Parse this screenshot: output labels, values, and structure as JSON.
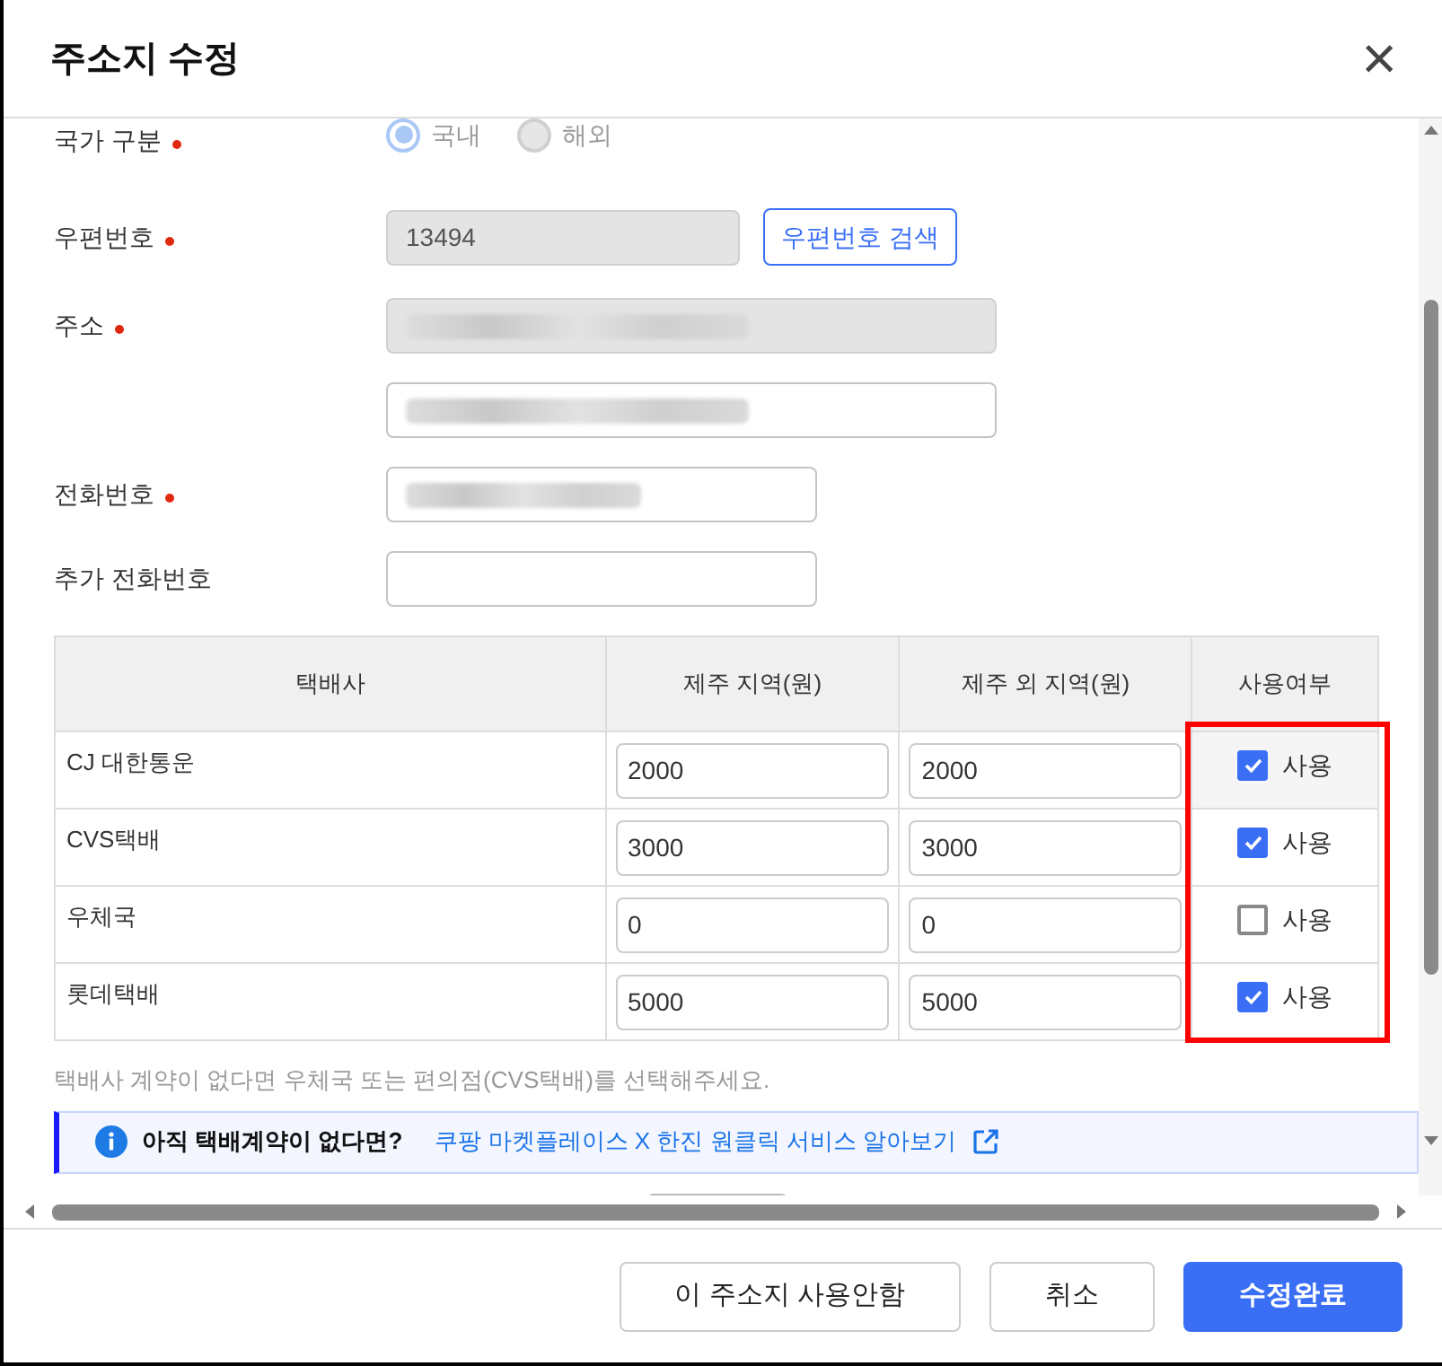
{
  "dialog": {
    "title": "주소지 수정",
    "close_label": "×"
  },
  "country": {
    "label": "국가 구분",
    "required": true,
    "disabled": true,
    "options": [
      {
        "label": "국내",
        "selected": true
      },
      {
        "label": "해외",
        "selected": false
      }
    ]
  },
  "zip": {
    "label": "우편번호",
    "required": true,
    "value": "13494",
    "readonly": true,
    "search_button": "우편번호 검색"
  },
  "address": {
    "label": "주소",
    "required": true,
    "lines": [
      {
        "readonly": true,
        "blurred": true
      },
      {
        "readonly": false,
        "blurred": true
      }
    ]
  },
  "phone": {
    "label": "전화번호",
    "required": true,
    "blurred": true
  },
  "extra_phone": {
    "label": "추가 전화번호",
    "required": false,
    "blurred": false
  },
  "table": {
    "columns": [
      "택배사",
      "제주 지역(원)",
      "제주 외 지역(원)",
      "사용여부"
    ],
    "highlight_usage_column": true,
    "rows": [
      {
        "carrier": "CJ 대한통운",
        "jeju": "2000",
        "other": "2000",
        "use_label": "사용",
        "checked": true
      },
      {
        "carrier": "CVS택배",
        "jeju": "3000",
        "other": "3000",
        "use_label": "사용",
        "checked": true
      },
      {
        "carrier": "우체국",
        "jeju": "0",
        "other": "0",
        "use_label": "사용",
        "checked": false
      },
      {
        "carrier": "롯데택배",
        "jeju": "5000",
        "other": "5000",
        "use_label": "사용",
        "checked": true
      }
    ]
  },
  "note": "택배사 계약이 없다면 우체국 또는 편의점(CVS택배)를 선택해주세요.",
  "banner": {
    "title": "아직 택배계약이 없다면?",
    "link": "쿠팡 마켓플레이스 X 한진 원클릭 서비스 알아보기"
  },
  "buttons": [
    {
      "label": "이 주소지 사용안함",
      "kind": "outline"
    },
    {
      "label": "취소",
      "kind": "outline"
    },
    {
      "label": "수정완료",
      "kind": "primary"
    }
  ]
}
